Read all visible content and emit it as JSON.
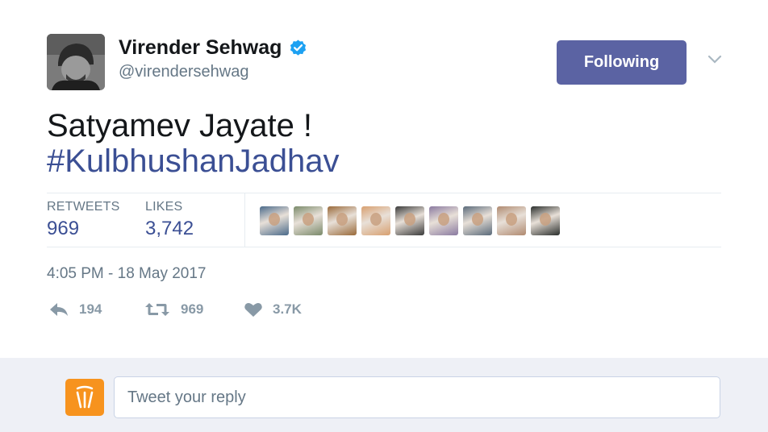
{
  "author": {
    "name": "Virender Sehwag",
    "handle": "@virendersehwag",
    "verified": true
  },
  "follow_button": {
    "label": "Following",
    "color": "#5b63a3"
  },
  "tweet": {
    "text": "Satyamev Jayate !",
    "hashtag": "#KulbhushanJadhav"
  },
  "stats": [
    {
      "label": "RETWEETS",
      "value": "969"
    },
    {
      "label": "LIKES",
      "value": "3,742"
    }
  ],
  "likers": [
    {
      "name": "liker-avatar-1",
      "color": "#4a6a8a"
    },
    {
      "name": "liker-avatar-2",
      "color": "#7a8a6a"
    },
    {
      "name": "liker-avatar-3",
      "color": "#9a6a3a"
    },
    {
      "name": "liker-avatar-4",
      "color": "#d8a070"
    },
    {
      "name": "liker-avatar-5",
      "color": "#3a3a3a"
    },
    {
      "name": "liker-avatar-6",
      "color": "#8a7aa0"
    },
    {
      "name": "liker-avatar-7",
      "color": "#5a6a7a"
    },
    {
      "name": "liker-avatar-8",
      "color": "#b08a70"
    },
    {
      "name": "liker-avatar-9",
      "color": "#2a2e2c"
    }
  ],
  "timestamp": "4:05 PM - 18 May 2017",
  "actions": {
    "reply_count": "194",
    "retweet_count": "969",
    "like_count": "3.7K"
  },
  "reply": {
    "placeholder": "Tweet your reply",
    "logo_color": "#f7931e"
  },
  "colors": {
    "accent": "#3b4f94",
    "muted": "#657786",
    "reply_bar_bg": "#eef0f6"
  }
}
